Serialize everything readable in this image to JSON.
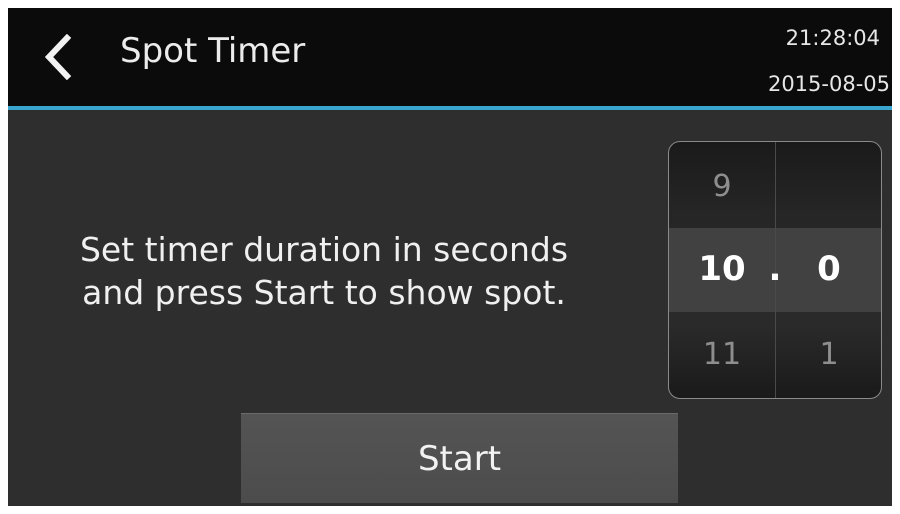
{
  "header": {
    "title": "Spot Timer",
    "back_icon": "chevron-left-icon",
    "time": "21:28:04",
    "date": "2015-08-05",
    "accent_color": "#3aa6d0"
  },
  "instruction": {
    "line1": "Set timer duration in seconds",
    "line2": "and press Start to show spot."
  },
  "picker": {
    "seconds": {
      "prev": "9",
      "current": "10",
      "next": "11"
    },
    "separator": ".",
    "tenths": {
      "prev": "",
      "current": "0",
      "next": "1"
    }
  },
  "start_button": {
    "label": "Start"
  }
}
